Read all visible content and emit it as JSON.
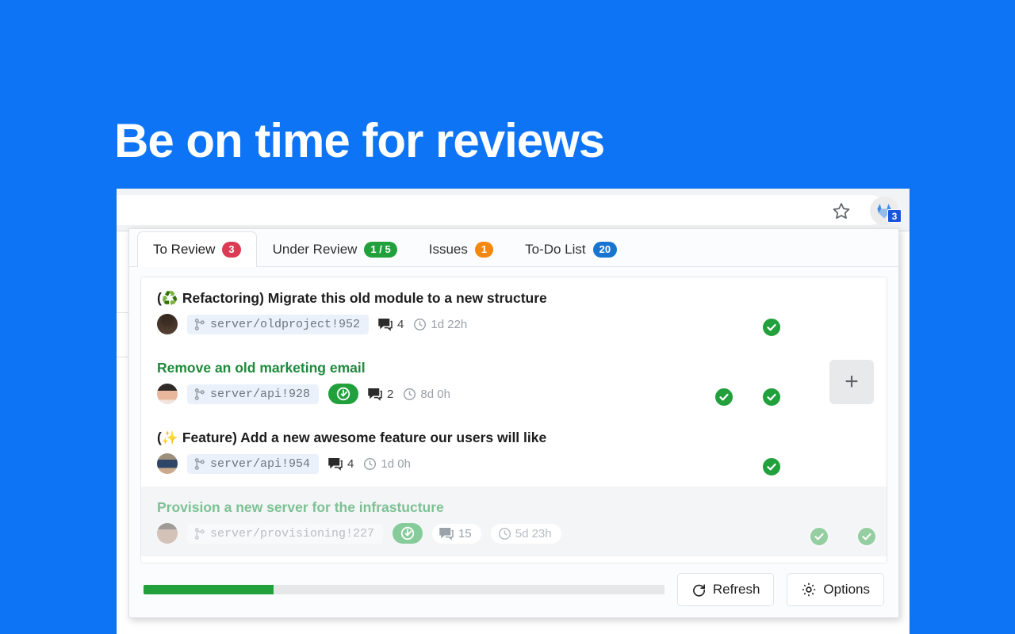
{
  "promo": {
    "headline": "Be on time for reviews"
  },
  "browser": {
    "star_icon": "star-icon",
    "extension_icon": "gitlab-extension-icon",
    "extension_badge": "3"
  },
  "popup": {
    "tabs": [
      {
        "label": "To Review",
        "badge": "3",
        "color": "red",
        "active": true
      },
      {
        "label": "Under Review",
        "badge": "1 / 5",
        "color": "green",
        "active": false
      },
      {
        "label": "Issues",
        "badge": "1",
        "color": "orange",
        "active": false
      },
      {
        "label": "To-Do List",
        "badge": "20",
        "color": "blue",
        "active": false
      }
    ],
    "rows": [
      {
        "emoji": "♻️",
        "title_prefix": "(",
        "title": " Refactoring) Migrate this old module to a new structure",
        "title_style": "dark",
        "reference": "server/oldproject!952",
        "pipeline": null,
        "comments": "4",
        "age": "1d 22h",
        "avatars": 3,
        "checks": [
          true,
          false,
          false
        ],
        "has_plus": false,
        "dim": false
      },
      {
        "emoji": "",
        "title_prefix": "",
        "title": "Remove an old marketing email",
        "title_style": "green",
        "reference": "server/api!928",
        "pipeline": "pending-icon",
        "comments": "2",
        "age": "8d 0h",
        "avatars": 3,
        "checks": [
          true,
          true,
          false
        ],
        "has_plus": true,
        "dim": false
      },
      {
        "emoji": "✨",
        "title_prefix": "(",
        "title": " Feature) Add a new awesome feature our users will like",
        "title_style": "dark",
        "reference": "server/api!954",
        "pipeline": null,
        "comments": "4",
        "age": "1d 0h",
        "avatars": 3,
        "checks": [
          true,
          false,
          false
        ],
        "has_plus": false,
        "dim": false
      },
      {
        "emoji": "",
        "title_prefix": "",
        "title": "Provision a new server for the infrastucture",
        "title_style": "green",
        "reference": "server/provisioning!227",
        "pipeline": "pending-icon",
        "comments": "15",
        "age": "5d 23h",
        "avatars": 2,
        "checks": [
          true,
          true
        ],
        "has_plus": false,
        "dim": true
      }
    ],
    "footer": {
      "progress_percent": 25,
      "refresh_label": "Refresh",
      "options_label": "Options"
    }
  },
  "colors": {
    "brand_blue": "#0d74f5",
    "badge_red": "#db3b54",
    "badge_green": "#21a03c",
    "badge_orange": "#f5870f",
    "badge_blue": "#1775d1",
    "title_green": "#1e8a3b"
  }
}
